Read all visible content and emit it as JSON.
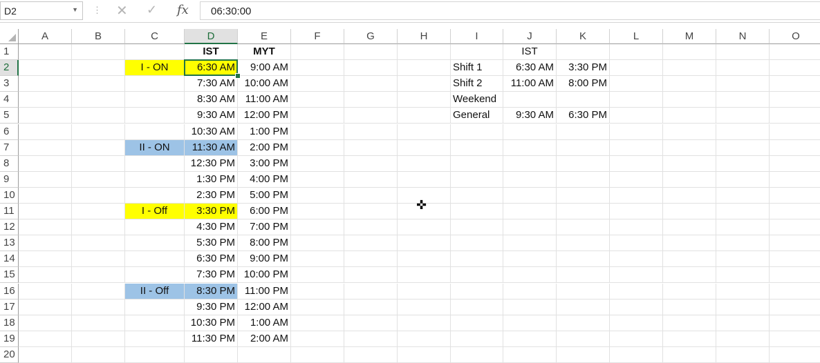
{
  "formula_bar": {
    "name_box": "D2",
    "name_box_icon": "chevron-down-icon",
    "separator_icon": "vertical-dots-icon",
    "cancel_icon": "✕",
    "enter_icon": "✓",
    "fx_label": "fx",
    "formula": "06:30:00"
  },
  "columns": [
    "A",
    "B",
    "C",
    "D",
    "E",
    "F",
    "G",
    "H",
    "I",
    "J",
    "K",
    "L",
    "M",
    "N",
    "O"
  ],
  "rows": [
    "1",
    "2",
    "3",
    "4",
    "5",
    "6",
    "7",
    "8",
    "9",
    "10",
    "11",
    "12",
    "13",
    "14",
    "15",
    "16",
    "17",
    "18",
    "19",
    "20"
  ],
  "selected": {
    "column": "D",
    "row": "2"
  },
  "colors": {
    "yellow": "#ffff00",
    "blue": "#9dc3e6",
    "accent": "#217346"
  },
  "cells": {
    "D1": "IST",
    "E1": "MYT",
    "C2": "I - ON",
    "D2": "6:30 AM",
    "E2": "9:00 AM",
    "D3": "7:30 AM",
    "E3": "10:00 AM",
    "D4": "8:30 AM",
    "E4": "11:00 AM",
    "D5": "9:30 AM",
    "E5": "12:00 PM",
    "D6": "10:30 AM",
    "E6": "1:00 PM",
    "C7": "II - ON",
    "D7": "11:30 AM",
    "E7": "2:00 PM",
    "D8": "12:30 PM",
    "E8": "3:00 PM",
    "D9": "1:30 PM",
    "E9": "4:00 PM",
    "D10": "2:30 PM",
    "E10": "5:00 PM",
    "C11": "I - Off",
    "D11": "3:30 PM",
    "E11": "6:00 PM",
    "D12": "4:30 PM",
    "E12": "7:00 PM",
    "D13": "5:30 PM",
    "E13": "8:00 PM",
    "D14": "6:30 PM",
    "E14": "9:00 PM",
    "D15": "7:30 PM",
    "E15": "10:00 PM",
    "C16": "II - Off",
    "D16": "8:30 PM",
    "E16": "11:00 PM",
    "D17": "9:30 PM",
    "E17": "12:00 AM",
    "D18": "10:30 PM",
    "E18": "1:00 AM",
    "D19": "11:30 PM",
    "E19": "2:00 AM",
    "J1": "IST",
    "I2": "Shift 1",
    "J2": "6:30 AM",
    "K2": "3:30 PM",
    "I3": "Shift 2",
    "J3": "11:00 AM",
    "K3": "8:00 PM",
    "I4": "Weekend",
    "I5": "General",
    "J5": "9:30 AM",
    "K5": "6:30 PM"
  },
  "cursor_icon": "✜"
}
